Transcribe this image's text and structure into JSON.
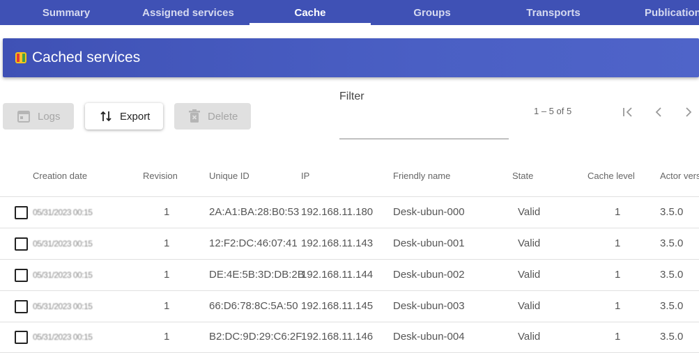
{
  "tabs": [
    "Summary",
    "Assigned services",
    "Cache",
    "Groups",
    "Transports",
    "Publications"
  ],
  "header": {
    "title": "Cached services"
  },
  "toolbar": {
    "logs": "Logs",
    "export": "Export",
    "delete": "Delete"
  },
  "filter": {
    "label": "Filter",
    "value": ""
  },
  "pagination": {
    "range": "1 – 5 of 5"
  },
  "table": {
    "columns": [
      "Creation date",
      "Revision",
      "Unique ID",
      "IP",
      "Friendly name",
      "State",
      "Cache level",
      "Actor version"
    ],
    "rows": [
      {
        "date": "05/31/2023 00:15",
        "revision": "1",
        "uid": "2A:A1:BA:28:B0:53",
        "ip": "192.168.11.180",
        "name": "Desk-ubun-000",
        "state": "Valid",
        "level": "1",
        "actor": "3.5.0"
      },
      {
        "date": "05/31/2023 00:15",
        "revision": "1",
        "uid": "12:F2:DC:46:07:41",
        "ip": "192.168.11.143",
        "name": "Desk-ubun-001",
        "state": "Valid",
        "level": "1",
        "actor": "3.5.0"
      },
      {
        "date": "05/31/2023 00:15",
        "revision": "1",
        "uid": "DE:4E:5B:3D:DB:2B",
        "ip": "192.168.11.144",
        "name": "Desk-ubun-002",
        "state": "Valid",
        "level": "1",
        "actor": "3.5.0"
      },
      {
        "date": "05/31/2023 00:15",
        "revision": "1",
        "uid": "66:D6:78:8C:5A:50",
        "ip": "192.168.11.145",
        "name": "Desk-ubun-003",
        "state": "Valid",
        "level": "1",
        "actor": "3.5.0"
      },
      {
        "date": "05/31/2023 00:15",
        "revision": "1",
        "uid": "B2:DC:9D:29:C6:2F",
        "ip": "192.168.11.146",
        "name": "Desk-ubun-004",
        "state": "Valid",
        "level": "1",
        "actor": "3.5.0"
      }
    ]
  },
  "colors": {
    "primary": "#3f51b5",
    "disabled_bg": "#e0e0e0"
  }
}
